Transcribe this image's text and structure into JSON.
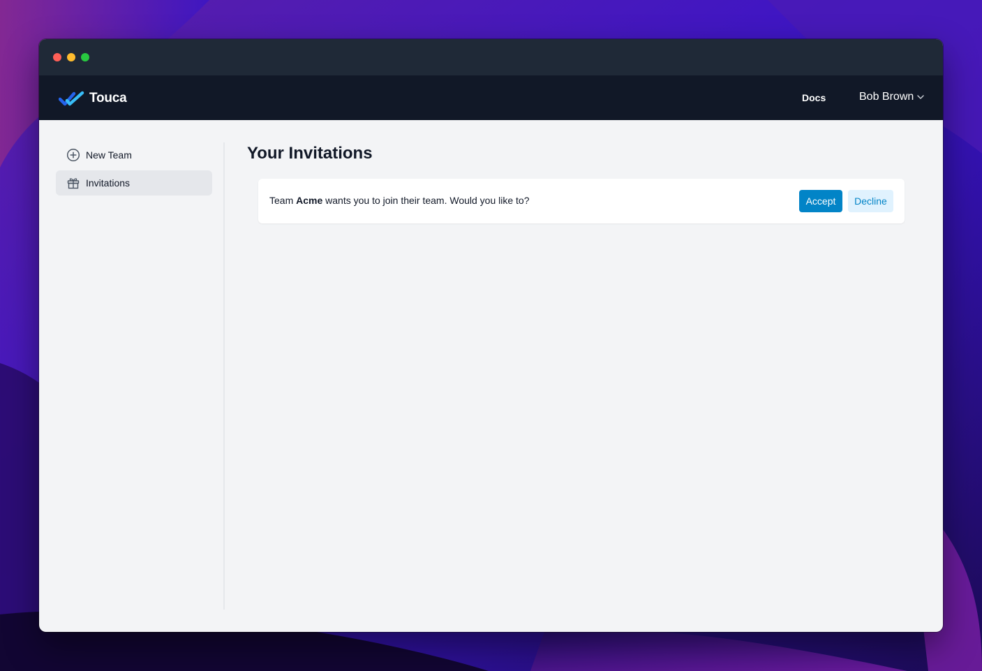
{
  "app": {
    "brand_name": "Touca",
    "colors": {
      "accent": "#0284c7",
      "accent_light": "#e0f2fe",
      "navbar": "#111827",
      "titlebar": "#1f2937",
      "page_background": "#f3f4f6"
    }
  },
  "navbar": {
    "docs_label": "Docs",
    "user_name": "Bob Brown",
    "user_menu_icon": "chevron-down-icon"
  },
  "sidebar": {
    "items": [
      {
        "label": "New Team",
        "icon": "plus-circle-icon",
        "active": false
      },
      {
        "label": "Invitations",
        "icon": "gift-icon",
        "active": true
      }
    ]
  },
  "main": {
    "title": "Your Invitations",
    "invitations": [
      {
        "prefix": "Team",
        "team_name": "Acme",
        "suffix": "wants you to join their team. Would you like to?",
        "accept_label": "Accept",
        "decline_label": "Decline"
      }
    ]
  },
  "help": {
    "label": "?"
  }
}
